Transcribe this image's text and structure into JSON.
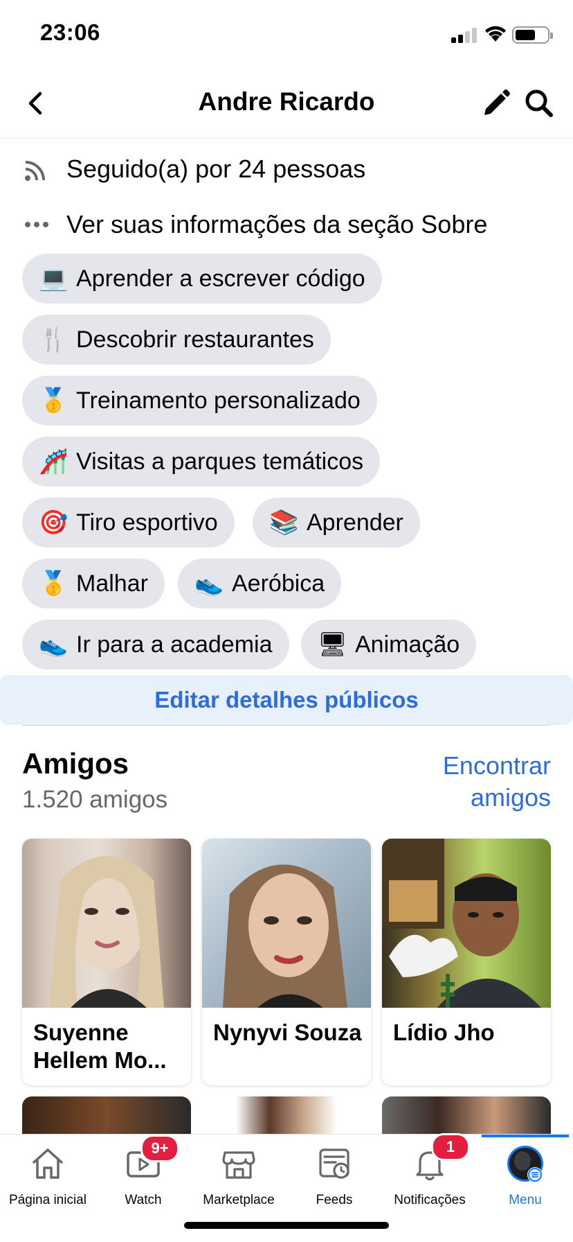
{
  "status_bar": {
    "time": "23:06"
  },
  "header": {
    "title": "Andre Ricardo"
  },
  "info": {
    "followers": "Seguido(a) por 24 pessoas",
    "about": "Ver suas informações da seção Sobre"
  },
  "interests": [
    {
      "emoji": "💻",
      "label": "Aprender a escrever código"
    },
    {
      "emoji": "🍴",
      "label": "Descobrir restaurantes"
    },
    {
      "emoji": "🥇",
      "label": "Treinamento personalizado"
    },
    {
      "emoji": "🎢",
      "label": "Visitas a parques temáticos"
    },
    {
      "emoji": "🎯",
      "label": "Tiro esportivo"
    },
    {
      "emoji": "📚",
      "label": "Aprender"
    },
    {
      "emoji": "🥇",
      "label": "Malhar"
    },
    {
      "emoji": "👟",
      "label": "Aeróbica"
    },
    {
      "emoji": "👟",
      "label": "Ir para a academia"
    },
    {
      "emoji": "🖥",
      "label": "Animação"
    }
  ],
  "edit_details_label": "Editar detalhes públicos",
  "friends": {
    "title": "Amigos",
    "count": "1.520 amigos",
    "find_label": "Encontrar amigos",
    "cards": [
      {
        "name": "Suyenne Hellem Mo..."
      },
      {
        "name": "Nynyvi Souza"
      },
      {
        "name": "Lídio Jho"
      }
    ]
  },
  "tab_bar": {
    "tabs": [
      {
        "label": "Página inicial",
        "icon": "home-icon"
      },
      {
        "label": "Watch",
        "icon": "video-icon",
        "badge": "9+"
      },
      {
        "label": "Marketplace",
        "icon": "store-icon"
      },
      {
        "label": "Feeds",
        "icon": "feeds-icon"
      },
      {
        "label": "Notificações",
        "icon": "bell-icon",
        "badge": "1"
      },
      {
        "label": "Menu",
        "icon": "avatar-icon",
        "active": true
      }
    ]
  },
  "colors": {
    "accent": "#1877f2",
    "link": "#2d6cdf",
    "chip_bg": "#e4e6eb",
    "badge": "#e41e3f"
  }
}
